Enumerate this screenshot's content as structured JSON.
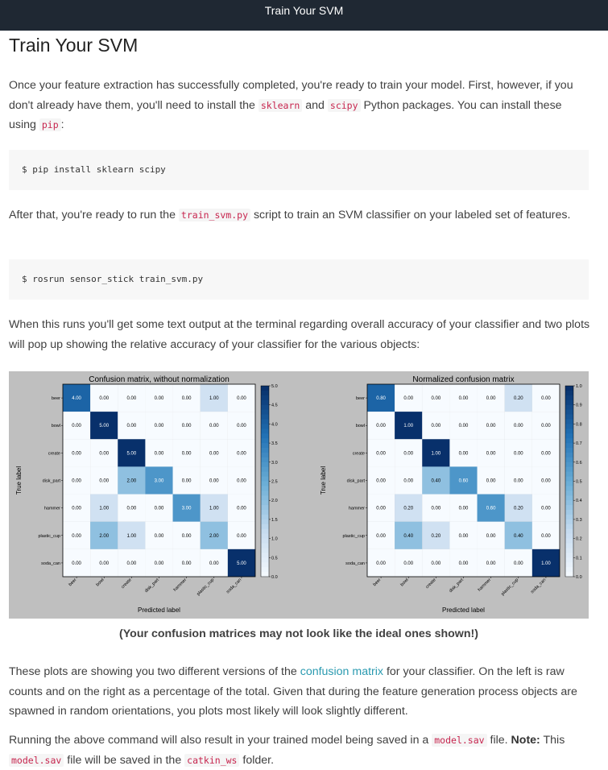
{
  "header": {
    "title": "Train Your SVM"
  },
  "page_title": "Train Your SVM",
  "intro": {
    "t1": "Once your feature extraction has successfully completed, you're ready to train your model. First, however, if you don't already have them, you'll need to install the ",
    "code1": "sklearn",
    "t2": " and ",
    "code2": "scipy",
    "t3": " Python packages. You can install these using ",
    "code3": "pip",
    "t4": ":"
  },
  "code_block_1": "$ pip install sklearn scipy",
  "after": {
    "t1": "After that, you're ready to run the ",
    "code1": "train_svm.py",
    "t2": " script to train an SVM classifier on your labeled set of features."
  },
  "code_block_2": "$ rosrun sensor_stick train_svm.py",
  "when": "When this runs you'll get some text output at the terminal regarding overall accuracy of your classifier and two plots will pop up showing the relative accuracy of your classifier for the various objects:",
  "caption": "(Your confusion matrices may not look like the ideal ones shown!)",
  "plots": {
    "t1": "These plots are showing you two different versions of the ",
    "link": "confusion matrix",
    "t2": " for your classifier. On the left is raw counts and on the right as a percentage of the total. Given that during the feature generation process objects are spawned in random orientations, you plots most likely will look slightly different."
  },
  "running": {
    "t1": "Running the above command will also result in your trained model being saved in a ",
    "code1": "model.sav",
    "t2": " file. ",
    "bold": "Note:",
    "t3": " This ",
    "code2": "model.sav",
    "t4": " file will be saved in the ",
    "code3": "catkin_ws",
    "t5": " folder."
  },
  "chart_data": [
    {
      "type": "heatmap",
      "title": "Confusion matrix, without normalization",
      "xlabel": "Predicted label",
      "ylabel": "True label",
      "categories": [
        "beer",
        "bowl",
        "create",
        "disk_part",
        "hammer",
        "plastic_cup",
        "soda_can"
      ],
      "values": [
        [
          4,
          0,
          0,
          0,
          0,
          1,
          0
        ],
        [
          0,
          5,
          0,
          0,
          0,
          0,
          0
        ],
        [
          0,
          0,
          5,
          0,
          0,
          0,
          0
        ],
        [
          0,
          0,
          2,
          3,
          0,
          0,
          0
        ],
        [
          0,
          1,
          0,
          0,
          3,
          1,
          0
        ],
        [
          0,
          2,
          1,
          0,
          0,
          2,
          0
        ],
        [
          0,
          0,
          0,
          0,
          0,
          0,
          5
        ]
      ],
      "colorbar_ticks": [
        "5.0",
        "4.5",
        "4.0",
        "3.5",
        "3.0",
        "2.5",
        "2.0",
        "1.5",
        "1.0",
        "0.5",
        "0.0"
      ],
      "vmax": 5
    },
    {
      "type": "heatmap",
      "title": "Normalized confusion matrix",
      "xlabel": "Predicted label",
      "ylabel": "True label",
      "categories": [
        "beer",
        "bowl",
        "create",
        "disk_part",
        "hammer",
        "plastic_cup",
        "soda_can"
      ],
      "values": [
        [
          0.8,
          0,
          0,
          0,
          0,
          0.2,
          0
        ],
        [
          0,
          1,
          0,
          0,
          0,
          0,
          0
        ],
        [
          0,
          0,
          1,
          0,
          0,
          0,
          0
        ],
        [
          0,
          0,
          0.4,
          0.6,
          0,
          0,
          0
        ],
        [
          0,
          0.2,
          0,
          0,
          0.6,
          0.2,
          0
        ],
        [
          0,
          0.4,
          0.2,
          0,
          0,
          0.4,
          0
        ],
        [
          0,
          0,
          0,
          0,
          0,
          0,
          1
        ]
      ],
      "colorbar_ticks": [
        "1.0",
        "0.9",
        "0.8",
        "0.7",
        "0.6",
        "0.5",
        "0.4",
        "0.3",
        "0.2",
        "0.1",
        "0.0"
      ],
      "vmax": 1
    }
  ]
}
